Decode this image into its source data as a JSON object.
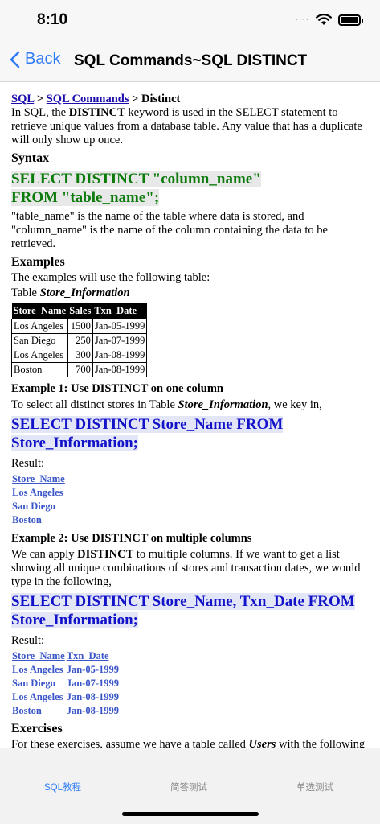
{
  "status": {
    "time": "8:10",
    "dots": "····"
  },
  "nav": {
    "back_label": "Back",
    "title": "SQL Commands~SQL DISTINCT"
  },
  "breadcrumb": {
    "sql": "SQL",
    "sep1": " > ",
    "commands": "SQL Commands",
    "sep2": " > ",
    "current": "Distinct"
  },
  "intro": {
    "pre": "In SQL, the ",
    "keyword": "DISTINCT",
    "post": " keyword is used in the SELECT statement to retrieve unique values from a database table. Any value that has a duplicate will only show up once."
  },
  "syntax": {
    "heading": "Syntax",
    "line1": "SELECT DISTINCT \"column_name\"",
    "line2": "FROM \"table_name\";",
    "desc": "\"table_name\" is the name of the table where data is stored, and \"column_name\" is the name of the column containing the data to be retrieved."
  },
  "examples": {
    "heading": "Examples",
    "intro": "The examples will use the following table:",
    "table_caption_pre": "Table ",
    "table_caption_name": "Store_Information",
    "columns": [
      "Store_Name",
      "Sales",
      "Txn_Date"
    ],
    "rows": [
      [
        "Los Angeles",
        "1500",
        "Jan-05-1999"
      ],
      [
        "San Diego",
        "250",
        "Jan-07-1999"
      ],
      [
        "Los Angeles",
        "300",
        "Jan-08-1999"
      ],
      [
        "Boston",
        "700",
        "Jan-08-1999"
      ]
    ]
  },
  "example1": {
    "heading": "Example 1: Use DISTINCT on one column",
    "desc_pre": "To select all distinct stores in Table ",
    "desc_name": "Store_Information",
    "desc_post": ", we key in,",
    "code": "SELECT DISTINCT Store_Name FROM Store_Information;",
    "result_label": "Result:",
    "result_header": "Store_Name",
    "result_rows": [
      "Los Angeles",
      "San Diego",
      "Boston"
    ]
  },
  "example2": {
    "heading": "Example 2: Use DISTINCT on multiple columns",
    "desc_pre": "We can apply ",
    "desc_keyword": "DISTINCT",
    "desc_post": " to multiple columns. If we want to get a list showing all unique combinations of stores and transaction dates, we would type in the following,",
    "code": "SELECT DISTINCT Store_Name, Txn_Date FROM Store_Information;",
    "result_label": "Result:",
    "result_headers": [
      "Store_Name",
      "Txn_Date"
    ],
    "result_rows": [
      [
        "Los Angeles",
        "Jan-05-1999"
      ],
      [
        "San Diego",
        "Jan-07-1999"
      ],
      [
        "Los Angeles",
        "Jan-08-1999"
      ],
      [
        "Boston",
        "Jan-08-1999"
      ]
    ]
  },
  "exercises": {
    "heading": "Exercises",
    "desc_pre": "For these exercises, assume we have a table called ",
    "desc_name": "Users",
    "desc_post": " with the following data:"
  },
  "tabs": [
    {
      "label": "SQL教程",
      "active": true
    },
    {
      "label": "简答测试",
      "active": false
    },
    {
      "label": "单选测试",
      "active": false
    }
  ],
  "colors": {
    "accent": "#2f7cf6",
    "link": "#1a0dab",
    "code_green": "#0a7a0a",
    "code_blue": "#1212c8",
    "result_blue": "#3a55c8"
  }
}
